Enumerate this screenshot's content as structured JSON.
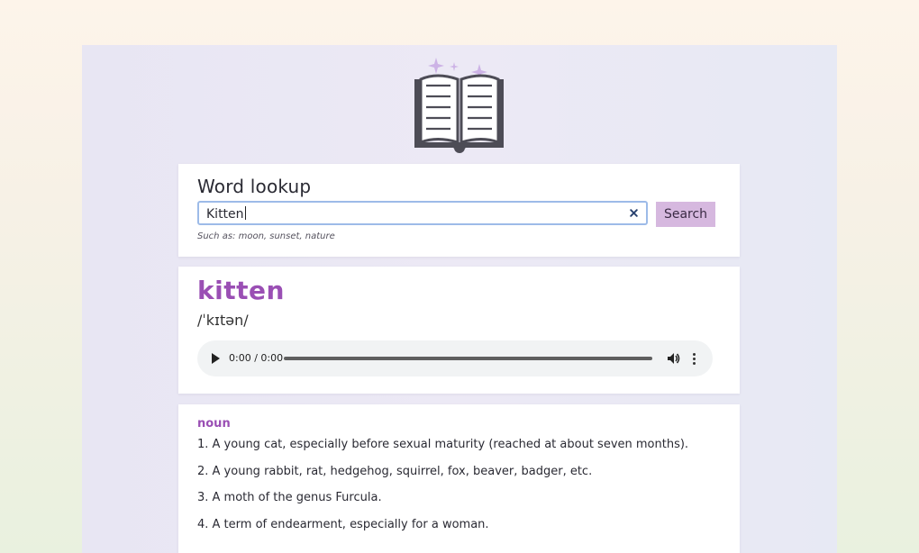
{
  "search": {
    "title": "Word lookup",
    "value": "Kitten",
    "hint": "Such as: moon, sunset, nature",
    "button_label": "Search"
  },
  "result": {
    "word": "kitten",
    "phonetic": "/ˈkɪtən/",
    "audio": {
      "time": "0:00 / 0:00"
    }
  },
  "definitions": {
    "part_of_speech": "noun",
    "items": [
      "1. A young cat, especially before sexual maturity (reached at about seven months).",
      "2. A young rabbit, rat, hedgehog, squirrel, fox, beaver, badger, etc.",
      "3. A moth of the genus Furcula.",
      "4. A term of endearment, especially for a woman."
    ]
  },
  "icons": {
    "logo": "open-book-sparkles-icon",
    "clear": "close-icon",
    "play": "play-icon",
    "volume": "volume-icon",
    "more": "more-vertical-icon"
  },
  "colors": {
    "accent": "#9a4fb4",
    "button": "#d6b8df",
    "focus_border": "#9dbbe8"
  }
}
